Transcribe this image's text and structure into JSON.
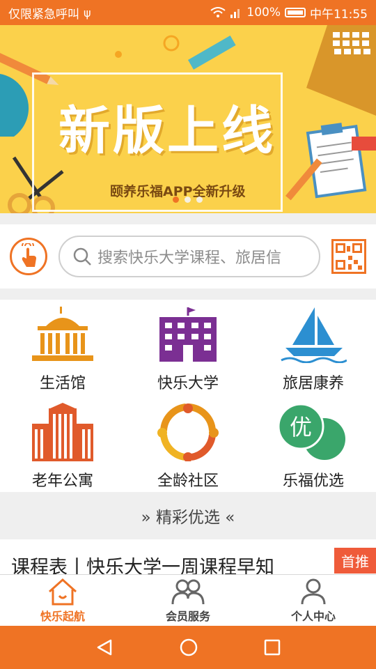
{
  "status_bar": {
    "left_text": "仅限紧急呼叫",
    "battery": "100%",
    "time": "中午11:55"
  },
  "banner": {
    "title": "新版上线",
    "subtitle": "颐养乐福APP全新升级",
    "slide_count": 3,
    "active_slide": 1
  },
  "search": {
    "placeholder": "搜索快乐大学课程、旅居信"
  },
  "grid": {
    "items": [
      {
        "label": "生活馆",
        "icon": "building-icon"
      },
      {
        "label": "快乐大学",
        "icon": "university-icon"
      },
      {
        "label": "旅居康养",
        "icon": "sailboat-icon"
      },
      {
        "label": "老年公寓",
        "icon": "apartment-icon"
      },
      {
        "label": "全龄社区",
        "icon": "community-icon"
      },
      {
        "label": "乐福优选",
        "icon": "you-select-icon"
      }
    ]
  },
  "section": {
    "title": "» 精彩优选 «"
  },
  "article": {
    "title": "课程表丨快乐大学一周课程早知",
    "badge": "首推"
  },
  "tabs": [
    {
      "label": "快乐起航",
      "icon": "home-icon",
      "active": true
    },
    {
      "label": "会员服务",
      "icon": "members-icon",
      "active": false
    },
    {
      "label": "个人中心",
      "icon": "person-icon",
      "active": false
    }
  ],
  "colors": {
    "accent": "#ef7324",
    "banner_bg": "#fbd14b",
    "purple": "#7b2f93",
    "blue": "#2c8fd1",
    "green": "#3aa66b"
  }
}
